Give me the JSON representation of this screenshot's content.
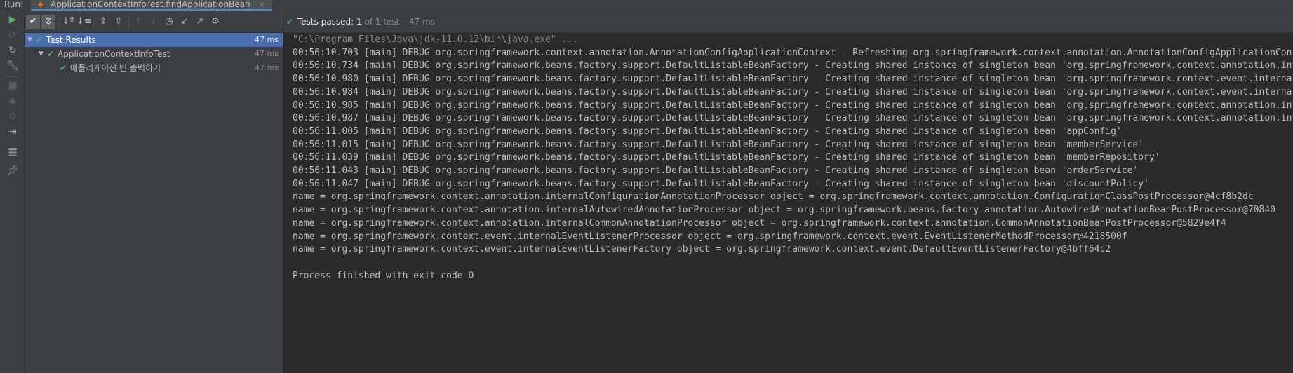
{
  "run_bar": {
    "label": "Run:",
    "tab_title": "ApplicationContextInfoTest.findApplicationBean",
    "tab_close": "×"
  },
  "status": {
    "check": "✔",
    "passed_label": "Tests passed:",
    "passed_count": "1",
    "of_total": "of 1 test – 47 ms"
  },
  "test_tree": [
    {
      "label": "Test Results",
      "time": "47 ms",
      "selected": true
    },
    {
      "label": "ApplicationContextInfoTest",
      "time": "47 ms",
      "selected": false
    },
    {
      "label": "애플리케이션 빈 출력하기",
      "time": "47 ms",
      "selected": false
    }
  ],
  "toolbar_icons": [
    "show-passed-icon",
    "show-ignored-icon",
    "sort-alphabetically-icon",
    "sort-by-duration-icon",
    "expand-all-icon",
    "collapse-all-icon",
    "previous-failed-icon",
    "next-failed-icon",
    "test-history-icon",
    "import-tests-icon",
    "export-tests-icon",
    "settings-gear-icon"
  ],
  "side_icons": [
    "rerun-icon",
    "rerun-failed-icon",
    "toggle-auto-test-icon",
    "wrench-icon",
    "stop-icon",
    "screenshot-icon",
    "dump-threads-icon",
    "exit-icon",
    "layout-icon",
    "pin-icon"
  ],
  "console": {
    "command": "\"C:\\Program Files\\Java\\jdk-11.0.12\\bin\\java.exe\" ...",
    "lines": [
      "00:56:10.703 [main] DEBUG org.springframework.context.annotation.AnnotationConfigApplicationContext - Refreshing org.springframework.context.annotation.AnnotationConfigApplicationContext",
      "00:56:10.734 [main] DEBUG org.springframework.beans.factory.support.DefaultListableBeanFactory - Creating shared instance of singleton bean 'org.springframework.context.annotation.internalConfigurationAnnotationProcessor'",
      "00:56:10.980 [main] DEBUG org.springframework.beans.factory.support.DefaultListableBeanFactory - Creating shared instance of singleton bean 'org.springframework.context.event.internalEventListenerProcessor'",
      "00:56:10.984 [main] DEBUG org.springframework.beans.factory.support.DefaultListableBeanFactory - Creating shared instance of singleton bean 'org.springframework.context.event.internalEventListenerFactory'",
      "00:56:10.985 [main] DEBUG org.springframework.beans.factory.support.DefaultListableBeanFactory - Creating shared instance of singleton bean 'org.springframework.context.annotation.internalAutowiredAnnotationProcessor'",
      "00:56:10.987 [main] DEBUG org.springframework.beans.factory.support.DefaultListableBeanFactory - Creating shared instance of singleton bean 'org.springframework.context.annotation.internalCommonAnnotationProcessor'",
      "00:56:11.005 [main] DEBUG org.springframework.beans.factory.support.DefaultListableBeanFactory - Creating shared instance of singleton bean 'appConfig'",
      "00:56:11.015 [main] DEBUG org.springframework.beans.factory.support.DefaultListableBeanFactory - Creating shared instance of singleton bean 'memberService'",
      "00:56:11.039 [main] DEBUG org.springframework.beans.factory.support.DefaultListableBeanFactory - Creating shared instance of singleton bean 'memberRepository'",
      "00:56:11.043 [main] DEBUG org.springframework.beans.factory.support.DefaultListableBeanFactory - Creating shared instance of singleton bean 'orderService'",
      "00:56:11.047 [main] DEBUG org.springframework.beans.factory.support.DefaultListableBeanFactory - Creating shared instance of singleton bean 'discountPolicy'",
      "name = org.springframework.context.annotation.internalConfigurationAnnotationProcessor object = org.springframework.context.annotation.ConfigurationClassPostProcessor@4cf8b2dc",
      "name = org.springframework.context.annotation.internalAutowiredAnnotationProcessor object = org.springframework.beans.factory.annotation.AutowiredAnnotationBeanPostProcessor@70840",
      "name = org.springframework.context.annotation.internalCommonAnnotationProcessor object = org.springframework.context.annotation.CommonAnnotationBeanPostProcessor@5829e4f4",
      "name = org.springframework.context.event.internalEventListenerProcessor object = org.springframework.context.event.EventListenerMethodProcessor@4218500f",
      "name = org.springframework.context.event.internalEventListenerFactory object = org.springframework.context.event.DefaultEventListenerFactory@4bff64c2",
      "",
      "Process finished with exit code 0"
    ]
  },
  "colors": {
    "pass_green": "#59a869",
    "selection_blue": "#4b6eaf",
    "panel_bg": "#3c3f41",
    "console_bg": "#2b2b2b"
  }
}
